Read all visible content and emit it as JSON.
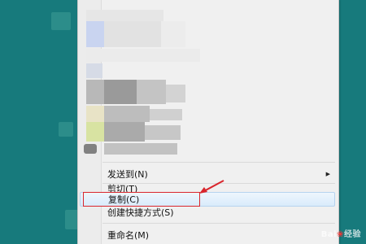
{
  "menu": {
    "items": [
      {
        "label": "发送到(N)",
        "has_submenu": true
      },
      {
        "label": "剪切(T)",
        "has_submenu": false
      },
      {
        "label": "复制(C)",
        "has_submenu": false,
        "highlighted": true
      },
      {
        "label": "创建快捷方式(S)",
        "has_submenu": false
      },
      {
        "label": "重命名(M)",
        "has_submenu": false
      }
    ]
  },
  "annotation": {
    "color": "#d9262d",
    "target": "复制(C)"
  },
  "watermark": {
    "text": "Baidu经验"
  },
  "colors": {
    "desktop": "#177a7c",
    "menu_bg": "#f0f0f0",
    "highlight": "#d9ebfb"
  }
}
